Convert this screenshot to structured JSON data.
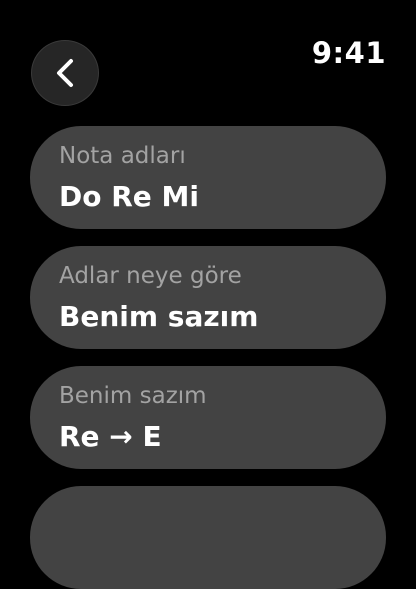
{
  "status_bar": {
    "time": "9:41"
  },
  "nav": {
    "back_icon": "chevron-left-icon"
  },
  "settings": {
    "items": [
      {
        "title": "Nota adları",
        "value": "Do Re Mi"
      },
      {
        "title": "Adlar neye göre",
        "value": "Benim sazım"
      },
      {
        "title": "Benim sazım",
        "value": "Re → E"
      }
    ]
  },
  "colors": {
    "background": "#000000",
    "row_background": "#434343",
    "secondary_text": "#a3a3a3",
    "primary_text": "#ffffff"
  }
}
